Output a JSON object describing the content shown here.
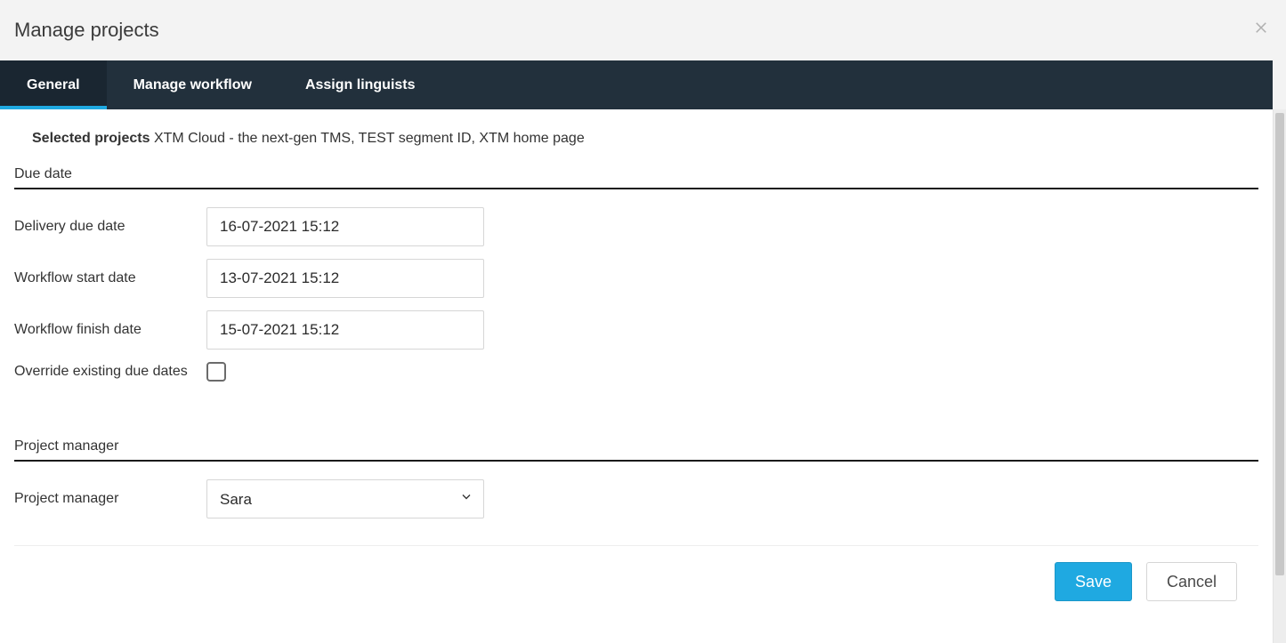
{
  "dialog": {
    "title": "Manage projects"
  },
  "tabs": {
    "general": "General",
    "workflow": "Manage workflow",
    "linguists": "Assign linguists"
  },
  "selected": {
    "label": "Selected projects",
    "value": "XTM Cloud - the next-gen TMS, TEST segment ID, XTM home page"
  },
  "sections": {
    "due_date": "Due date",
    "project_manager": "Project manager"
  },
  "fields": {
    "delivery_due": {
      "label": "Delivery due date",
      "value": "16-07-2021 15:12"
    },
    "workflow_start": {
      "label": "Workflow start date",
      "value": "13-07-2021 15:12"
    },
    "workflow_finish": {
      "label": "Workflow finish date",
      "value": "15-07-2021 15:12"
    },
    "override": {
      "label": "Override existing due dates",
      "checked": false
    },
    "pm": {
      "label": "Project manager",
      "value": "Sara"
    }
  },
  "buttons": {
    "save": "Save",
    "cancel": "Cancel"
  }
}
